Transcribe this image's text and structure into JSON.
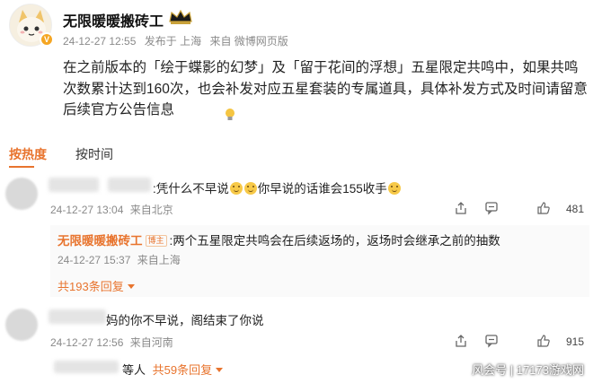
{
  "post": {
    "author": "无限暖暖搬砖工",
    "time": "24-12-27 12:55",
    "published_in": "发布于 上海",
    "source": "来自 微博网页版",
    "text": "在之前版本的「绘于蝶影的幻梦」及「留于花间的浮想」五星限定共鸣中，如果共鸣次数累计达到160次，也会补发对应五星套装的专属道具，具体补发方式及时间请留意后续官方公告信息"
  },
  "sort": {
    "hot": "按热度",
    "time": "按时间"
  },
  "comments": [
    {
      "text": ":凭什么不早说",
      "text2": "你早说的话谁会155收手",
      "time": "24-12-27 13:04",
      "location": "来自北京",
      "likes": "481",
      "reply": {
        "author": "无限暖暖搬砖工",
        "tag": "博主",
        "text": ":两个五星限定共鸣会在后续返场的，返场时会继承之前的抽数",
        "time": "24-12-27 15:37",
        "location": "来自上海"
      },
      "more_replies": "共193条回复"
    },
    {
      "text": "妈的你不早说，阁结束了你说",
      "time": "24-12-27 12:56",
      "location": "来自河南",
      "likes": "915",
      "reply_preview_suffix": "等人",
      "more_replies": "共59条回复"
    }
  ],
  "watermark": "风会号 | 17173游戏网",
  "colors": {
    "accent": "#e8742e",
    "meta": "#8a8a8a"
  }
}
